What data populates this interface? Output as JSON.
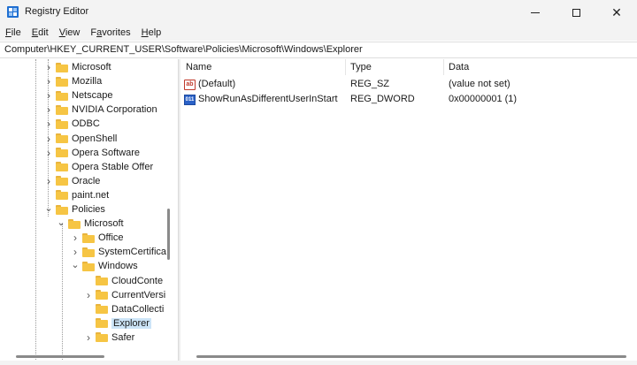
{
  "window": {
    "title": "Registry Editor",
    "controls": {
      "minimize": "minimize-icon",
      "maximize": "maximize-icon",
      "close": "✕"
    }
  },
  "menu": [
    {
      "label": "File",
      "key": "F",
      "rest": "ile"
    },
    {
      "label": "Edit",
      "key": "E",
      "rest": "dit"
    },
    {
      "label": "View",
      "key": "V",
      "rest": "iew"
    },
    {
      "label": "Favorites",
      "key": "a",
      "pre": "F",
      "rest": "vorites"
    },
    {
      "label": "Help",
      "key": "H",
      "rest": "elp"
    }
  ],
  "address": "Computer\\HKEY_CURRENT_USER\\Software\\Policies\\Microsoft\\Windows\\Explorer",
  "tree": [
    {
      "label": "Microsoft",
      "level": 0,
      "chevron": "right"
    },
    {
      "label": "Mozilla",
      "level": 0,
      "chevron": "right"
    },
    {
      "label": "Netscape",
      "level": 0,
      "chevron": "right"
    },
    {
      "label": "NVIDIA Corporation",
      "level": 0,
      "chevron": "right"
    },
    {
      "label": "ODBC",
      "level": 0,
      "chevron": "right"
    },
    {
      "label": "OpenShell",
      "level": 0,
      "chevron": "right"
    },
    {
      "label": "Opera Software",
      "level": 0,
      "chevron": "right"
    },
    {
      "label": "Opera Stable Offer",
      "level": 0,
      "chevron": "none"
    },
    {
      "label": "Oracle",
      "level": 0,
      "chevron": "right"
    },
    {
      "label": "paint.net",
      "level": 0,
      "chevron": "none"
    },
    {
      "label": "Policies",
      "level": 0,
      "chevron": "down"
    },
    {
      "label": "Microsoft",
      "level": 1,
      "chevron": "down"
    },
    {
      "label": "Office",
      "level": 2,
      "chevron": "right"
    },
    {
      "label": "SystemCertifica",
      "level": 2,
      "chevron": "right"
    },
    {
      "label": "Windows",
      "level": 2,
      "chevron": "down"
    },
    {
      "label": "CloudConte",
      "level": 3,
      "chevron": "none"
    },
    {
      "label": "CurrentVersi",
      "level": 3,
      "chevron": "right"
    },
    {
      "label": "DataCollecti",
      "level": 3,
      "chevron": "none"
    },
    {
      "label": "Explorer",
      "level": 3,
      "chevron": "none",
      "selected": true
    },
    {
      "label": "Safer",
      "level": 3,
      "chevron": "right"
    }
  ],
  "list": {
    "columns": {
      "name": "Name",
      "type": "Type",
      "data": "Data"
    },
    "rows": [
      {
        "icon": "string-value-icon",
        "icon_text": "ab",
        "name": "(Default)",
        "type": "REG_SZ",
        "data": "(value not set)"
      },
      {
        "icon": "binary-value-icon",
        "icon_text": "011",
        "name": "ShowRunAsDifferentUserInStart",
        "type": "REG_DWORD",
        "data": "0x00000001 (1)"
      }
    ]
  },
  "colors": {
    "selection": "#cce4f7",
    "folder": "#f6c544",
    "chrome": "#f3f3f3"
  }
}
